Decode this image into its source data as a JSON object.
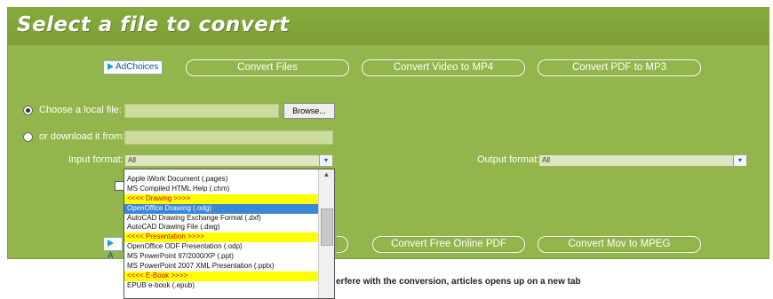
{
  "header": {
    "title": "Select a file to convert"
  },
  "ads_top": {
    "adchoices": "AdChoices",
    "buttons": [
      "Convert Files",
      "Convert Video to MP4",
      "Convert PDF to MP3"
    ]
  },
  "ads_bottom": {
    "adchoices_partial": "A",
    "buttons": [
      "Convert Free Online PDF",
      "Convert Mov to MPEG"
    ]
  },
  "source": {
    "local_label": "Choose a local file:",
    "local_value": "",
    "browse_label": "Browse...",
    "download_label": "or download it from:",
    "download_value": "",
    "selected": "local"
  },
  "input_format": {
    "label": "Input format:",
    "selected": "All",
    "arrow": "▾",
    "options": [
      {
        "text": "Apple iWork Document (.pages)",
        "type": "item"
      },
      {
        "text": "MS Compiled HTML Help (.chm)",
        "type": "item"
      },
      {
        "text": "<<<< Drawing >>>>",
        "type": "header"
      },
      {
        "text": "OpenOffice Drawing (.odg)",
        "type": "selected"
      },
      {
        "text": "AutoCAD Drawing Exchange Format (.dxf)",
        "type": "item"
      },
      {
        "text": "AutoCAD Drawing File (.dwg)",
        "type": "item"
      },
      {
        "text": "<<<< Presentation >>>>",
        "type": "header"
      },
      {
        "text": "OpenOffice ODF Presentation (.odp)",
        "type": "item"
      },
      {
        "text": "MS PowerPoint 97/2000/XP (.ppt)",
        "type": "item"
      },
      {
        "text": "MS PowerPoint 2007 XML Presentation (.pptx)",
        "type": "item"
      },
      {
        "text": "<<<< E-Book >>>>",
        "type": "header"
      },
      {
        "text": "EPUB e-book (.epub)",
        "type": "item"
      }
    ],
    "scroll_up": "▲"
  },
  "output_format": {
    "label": "Output format:",
    "selected": "All",
    "arrow": "▾"
  },
  "note": "erfere with the conversion, articles opens up on a new tab"
}
